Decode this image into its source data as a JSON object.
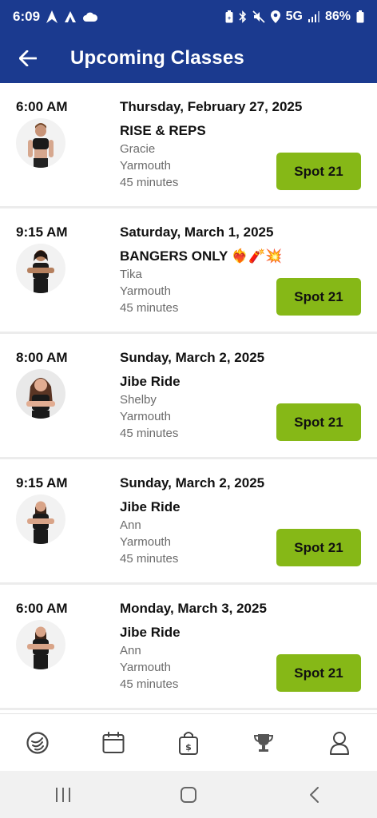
{
  "status_bar": {
    "time": "6:09",
    "network": "5G",
    "battery": "86%",
    "icons": [
      "navigation-icon",
      "app-icon",
      "cloud-icon",
      "battery-saver-icon",
      "bluetooth-icon",
      "mute-icon",
      "location-icon",
      "signal-icon",
      "battery-icon"
    ]
  },
  "header": {
    "title": "Upcoming Classes",
    "back_icon": "arrow-left-icon"
  },
  "classes": [
    {
      "time": "6:00 AM",
      "date": "Thursday, February 27, 2025",
      "name": "RISE & REPS",
      "instructor": "Gracie",
      "location": "Yarmouth",
      "duration": "45 minutes",
      "spot": "Spot 21"
    },
    {
      "time": "9:15 AM",
      "date": "Saturday, March 1, 2025",
      "name": "BANGERS ONLY ❤️‍🔥🧨💥",
      "instructor": "Tika",
      "location": "Yarmouth",
      "duration": "45 minutes",
      "spot": "Spot 21"
    },
    {
      "time": "8:00 AM",
      "date": "Sunday, March 2, 2025",
      "name": "Jibe Ride",
      "instructor": "Shelby",
      "location": "Yarmouth",
      "duration": "45 minutes",
      "spot": "Spot 21"
    },
    {
      "time": "9:15 AM",
      "date": "Sunday, March 2, 2025",
      "name": "Jibe Ride",
      "instructor": "Ann",
      "location": "Yarmouth",
      "duration": "45 minutes",
      "spot": "Spot 21"
    },
    {
      "time": "6:00 AM",
      "date": "Monday, March 3, 2025",
      "name": "Jibe Ride",
      "instructor": "Ann",
      "location": "Yarmouth",
      "duration": "45 minutes",
      "spot": "Spot 21"
    }
  ],
  "bottom_nav": {
    "items": [
      "jibe-logo-icon",
      "calendar-icon",
      "shopping-bag-icon",
      "trophy-icon",
      "profile-icon"
    ]
  },
  "system_nav": {
    "items": [
      "recent-apps-icon",
      "home-icon",
      "back-icon"
    ]
  },
  "colors": {
    "header_bg": "#1b3a8f",
    "spot_button": "#86b817",
    "divider": "#ececec"
  }
}
